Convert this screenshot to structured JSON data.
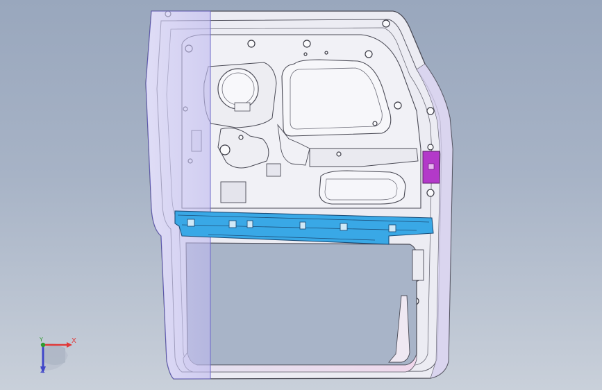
{
  "viewport": {
    "background_top": "#99a7bd",
    "background_bottom": "#c9d0da"
  },
  "model": {
    "body_color": "#e9e9f0",
    "edge_color": "#4a4a55",
    "selection_tint": "#c7c3f2",
    "beam_color": "#39a8e6",
    "bracket_color": "#b339c9"
  },
  "triad": {
    "x_label": "X",
    "y_label": "Y",
    "z_label": "Z",
    "x_color": "#e03a3a",
    "y_color": "#2f9a2f",
    "z_color": "#3f45c8",
    "icon": "coordinate-triad-icon"
  }
}
